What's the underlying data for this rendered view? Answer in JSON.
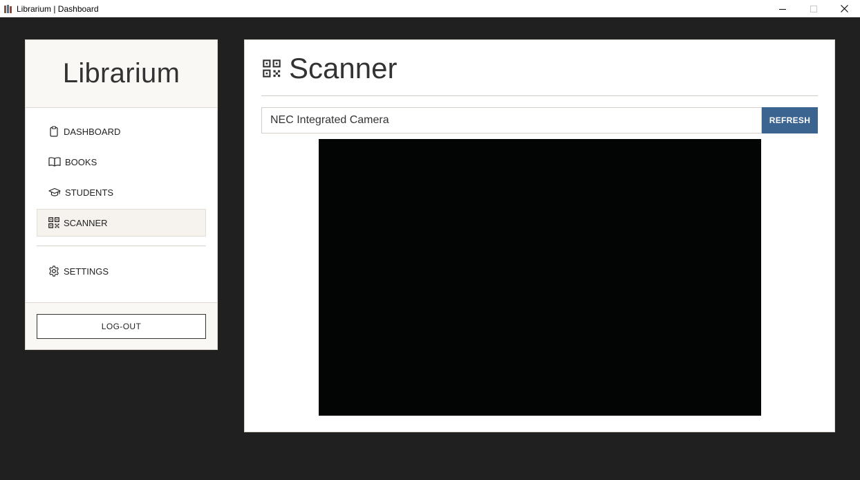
{
  "window": {
    "title": "Librarium | Dashboard"
  },
  "sidebar": {
    "brand": "Librarium",
    "items": [
      {
        "label": "DASHBOARD",
        "icon": "clipboard-icon",
        "active": false
      },
      {
        "label": "BOOKS",
        "icon": "book-open-icon",
        "active": false
      },
      {
        "label": "STUDENTS",
        "icon": "graduation-cap-icon",
        "active": false
      },
      {
        "label": "SCANNER",
        "icon": "qr-code-icon",
        "active": true
      }
    ],
    "settings_label": "SETTINGS",
    "logout_label": "LOG-OUT"
  },
  "main": {
    "title": "Scanner",
    "title_icon": "qr-code-icon",
    "camera_selected": "NEC Integrated Camera",
    "refresh_label": "REFRESH"
  },
  "colors": {
    "background": "#202020",
    "accent": "#3c6491",
    "active_nav": "#f6f3ef",
    "video": "#030404"
  }
}
